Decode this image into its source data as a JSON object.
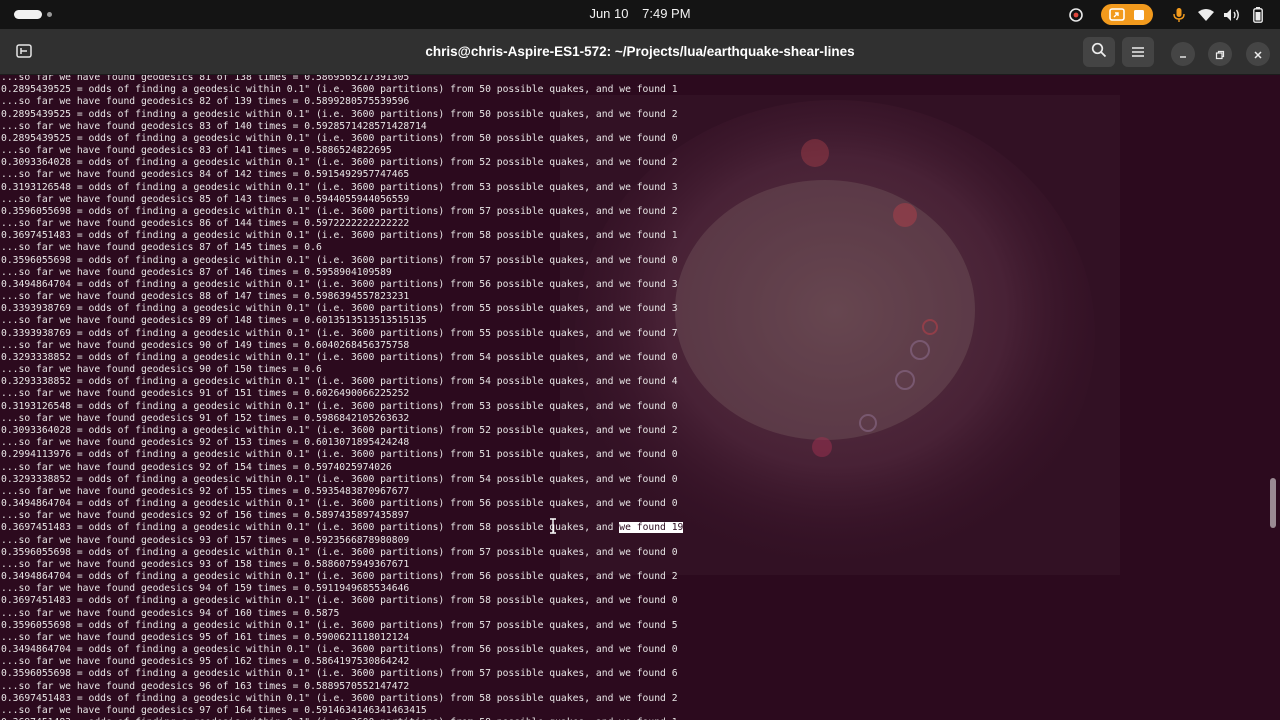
{
  "topbar": {
    "date": "Jun 10",
    "time": "7:49 PM",
    "accent_color": "#f29a1d"
  },
  "window": {
    "title": "chris@chris-Aspire-ES1-572: ~/Projects/lua/earthquake-shear-lines"
  },
  "terminal": {
    "background": "#2c0a1e",
    "lines": [
      "...so far we have found geodesics 81 of 138 times = 0.5869565217391305",
      "0.2895439525 = odds of finding a geodesic within 0.1\" (i.e. 3600 partitions) from 50 possible quakes, and we found 1",
      "...so far we have found geodesics 82 of 139 times = 0.5899280575539596",
      "0.2895439525 = odds of finding a geodesic within 0.1\" (i.e. 3600 partitions) from 50 possible quakes, and we found 2",
      "...so far we have found geodesics 83 of 140 times = 0.5928571428571428714",
      "0.2895439525 = odds of finding a geodesic within 0.1\" (i.e. 3600 partitions) from 50 possible quakes, and we found 0",
      "...so far we have found geodesics 83 of 141 times = 0.5886524822695",
      "0.3093364028 = odds of finding a geodesic within 0.1\" (i.e. 3600 partitions) from 52 possible quakes, and we found 2",
      "...so far we have found geodesics 84 of 142 times = 0.5915492957747465",
      "0.3193126548 = odds of finding a geodesic within 0.1\" (i.e. 3600 partitions) from 53 possible quakes, and we found 3",
      "...so far we have found geodesics 85 of 143 times = 0.5944055944056559",
      "0.3596055698 = odds of finding a geodesic within 0.1\" (i.e. 3600 partitions) from 57 possible quakes, and we found 2",
      "...so far we have found geodesics 86 of 144 times = 0.5972222222222222",
      "0.3697451483 = odds of finding a geodesic within 0.1\" (i.e. 3600 partitions) from 58 possible quakes, and we found 1",
      "...so far we have found geodesics 87 of 145 times = 0.6",
      "0.3596055698 = odds of finding a geodesic within 0.1\" (i.e. 3600 partitions) from 57 possible quakes, and we found 0",
      "...so far we have found geodesics 87 of 146 times = 0.5958904109589",
      "0.3494864704 = odds of finding a geodesic within 0.1\" (i.e. 3600 partitions) from 56 possible quakes, and we found 3",
      "...so far we have found geodesics 88 of 147 times = 0.5986394557823231",
      "0.3393938769 = odds of finding a geodesic within 0.1\" (i.e. 3600 partitions) from 55 possible quakes, and we found 3",
      "...so far we have found geodesics 89 of 148 times = 0.6013513513513515135",
      "0.3393938769 = odds of finding a geodesic within 0.1\" (i.e. 3600 partitions) from 55 possible quakes, and we found 7",
      "...so far we have found geodesics 90 of 149 times = 0.6040268456375758",
      "0.3293338852 = odds of finding a geodesic within 0.1\" (i.e. 3600 partitions) from 54 possible quakes, and we found 0",
      "...so far we have found geodesics 90 of 150 times = 0.6",
      "0.3293338852 = odds of finding a geodesic within 0.1\" (i.e. 3600 partitions) from 54 possible quakes, and we found 4",
      "...so far we have found geodesics 91 of 151 times = 0.6026490066225252",
      "0.3193126548 = odds of finding a geodesic within 0.1\" (i.e. 3600 partitions) from 53 possible quakes, and we found 0",
      "...so far we have found geodesics 91 of 152 times = 0.5986842105263632",
      "0.3093364028 = odds of finding a geodesic within 0.1\" (i.e. 3600 partitions) from 52 possible quakes, and we found 2",
      "...so far we have found geodesics 92 of 153 times = 0.6013071895424248",
      "0.2994113976 = odds of finding a geodesic within 0.1\" (i.e. 3600 partitions) from 51 possible quakes, and we found 0",
      "...so far we have found geodesics 92 of 154 times = 0.5974025974026",
      "0.3293338852 = odds of finding a geodesic within 0.1\" (i.e. 3600 partitions) from 54 possible quakes, and we found 0",
      "...so far we have found geodesics 92 of 155 times = 0.5935483870967677",
      "0.3494864704 = odds of finding a geodesic within 0.1\" (i.e. 3600 partitions) from 56 possible quakes, and we found 0",
      "...so far we have found geodesics 92 of 156 times = 0.5897435897435897",
      "0.3697451483 = odds of finding a geodesic within 0.1\" (i.e. 3600 partitions) from 58 possible quakes, and ",
      "...so far we have found geodesics 93 of 157 times = 0.5923566878980809",
      "0.3596055698 = odds of finding a geodesic within 0.1\" (i.e. 3600 partitions) from 57 possible quakes, and we found 0",
      "...so far we have found geodesics 93 of 158 times = 0.5886075949367671",
      "0.3494864704 = odds of finding a geodesic within 0.1\" (i.e. 3600 partitions) from 56 possible quakes, and we found 2",
      "...so far we have found geodesics 94 of 159 times = 0.5911949685534646",
      "0.3697451483 = odds of finding a geodesic within 0.1\" (i.e. 3600 partitions) from 58 possible quakes, and we found 0",
      "...so far we have found geodesics 94 of 160 times = 0.5875",
      "0.3596055698 = odds of finding a geodesic within 0.1\" (i.e. 3600 partitions) from 57 possible quakes, and we found 5",
      "...so far we have found geodesics 95 of 161 times = 0.5900621118012124",
      "0.3494864704 = odds of finding a geodesic within 0.1\" (i.e. 3600 partitions) from 56 possible quakes, and we found 0",
      "...so far we have found geodesics 95 of 162 times = 0.5864197530864242",
      "0.3596055698 = odds of finding a geodesic within 0.1\" (i.e. 3600 partitions) from 57 possible quakes, and we found 6",
      "...so far we have found geodesics 96 of 163 times = 0.5889570552147472",
      "0.3697451483 = odds of finding a geodesic within 0.1\" (i.e. 3600 partitions) from 58 possible quakes, and we found 2",
      "...so far we have found geodesics 97 of 164 times = 0.5914634146341463415",
      "0.3697451483 = odds of finding a geodesic within 0.1\" (i.e. 3600 partitions) from 58 possible quakes, and we found 1"
    ],
    "selected_text": "we found 19",
    "selected_line_index": 37
  }
}
